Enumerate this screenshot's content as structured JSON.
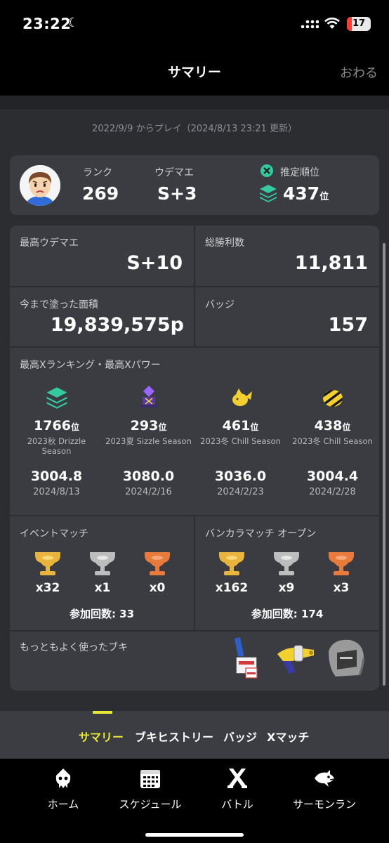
{
  "status": {
    "time": "23:22",
    "battery": "17"
  },
  "nav": {
    "title": "サマリー",
    "close": "おわる"
  },
  "play_since": "2022/9/9 からプレイ（2024/8/13 23:21 更新）",
  "profile": {
    "rank_label": "ランク",
    "rank": "269",
    "udemae_label": "ウデマエ",
    "udemae": "S+3",
    "xrank_label": "推定順位",
    "xrank": "437",
    "xrank_suffix": "位"
  },
  "stats": {
    "max_udemae_label": "最高ウデマエ",
    "max_udemae": "S+10",
    "wins_label": "総勝利数",
    "wins": "11,811",
    "painted_label": "今まで塗った面積",
    "painted": "19,839,575p",
    "badges_label": "バッジ",
    "badges": "157"
  },
  "xranking": {
    "title": "最高Xランキング・最高Xパワー",
    "seasons": [
      {
        "rank": "1766",
        "suffix": "位",
        "season": "2023秋 Drizzle Season",
        "power": "3004.8",
        "date": "2024/8/13"
      },
      {
        "rank": "293",
        "suffix": "位",
        "season": "2023夏 Sizzle Season",
        "power": "3080.0",
        "date": "2024/2/16"
      },
      {
        "rank": "461",
        "suffix": "位",
        "season": "2023冬 Chill Season",
        "power": "3036.0",
        "date": "2024/2/23"
      },
      {
        "rank": "438",
        "suffix": "位",
        "season": "2023冬 Chill Season",
        "power": "3004.4",
        "date": "2024/2/28"
      }
    ]
  },
  "event_match": {
    "title": "イベントマッチ",
    "gold": "x32",
    "silver": "x1",
    "bronze": "x0",
    "participation": "参加回数: 33"
  },
  "bankara_open": {
    "title": "バンカラマッチ オープン",
    "gold": "x162",
    "silver": "x9",
    "bronze": "x3",
    "participation": "参加回数: 174"
  },
  "weapons": {
    "title": "もっともよく使ったブキ"
  },
  "tabs": [
    "サマリー",
    "ブキヒストリー",
    "バッジ",
    "Xマッチ"
  ],
  "bottom_nav": [
    "ホーム",
    "スケジュール",
    "バトル",
    "サーモンラン"
  ],
  "colors": {
    "accent": "#e8e838",
    "gold": "#e8b43c",
    "silver": "#bdbdbd",
    "bronze": "#e87a3c",
    "xgreen": "#35c9a0"
  }
}
